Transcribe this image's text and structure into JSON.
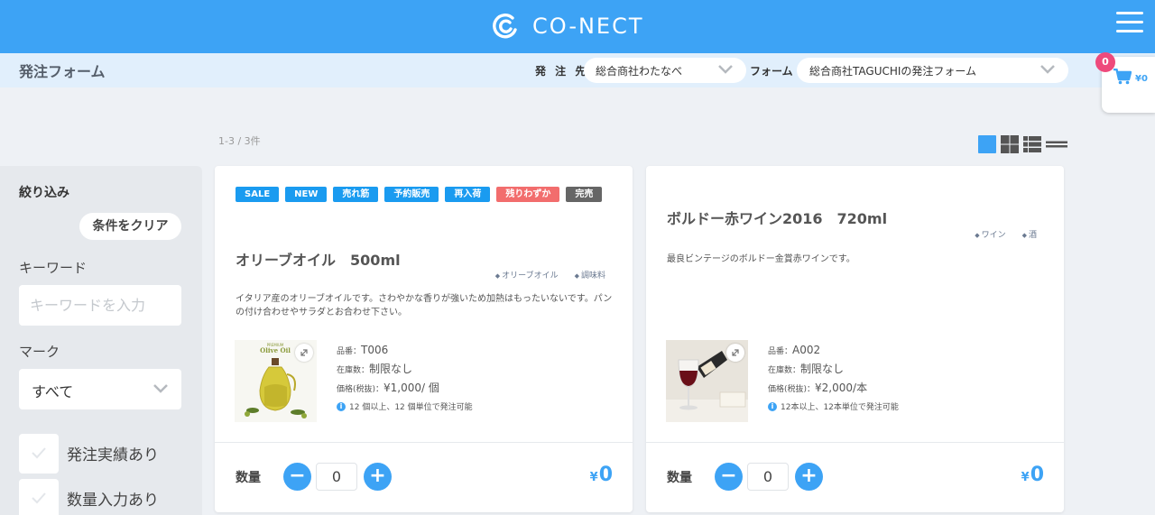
{
  "header": {
    "brand": "CO-NECT",
    "menu_icon": "hamburger-icon"
  },
  "subheader": {
    "page_title": "発注フォーム",
    "destination_label": "発 注 先",
    "destination_value": "総合商社わたなべ",
    "form_label": "フォーム",
    "form_value": "総合商社TAGUCHIの発注フォーム"
  },
  "cart": {
    "count": "0",
    "total": "¥0"
  },
  "listing": {
    "count": "1-3 / 3件"
  },
  "filters": {
    "title": "絞り込み",
    "clear_button": "条件をクリア",
    "keyword_label": "キーワード",
    "keyword_placeholder": "キーワードを入力",
    "mark_label": "マーク",
    "mark_value": "すべて",
    "checkboxes": [
      {
        "label": "発注実績あり"
      },
      {
        "label": "数量入力あり"
      }
    ]
  },
  "colors": {
    "primary": "#3da3f5",
    "tag_blue": "#1a9bf0",
    "tag_red": "#f26d6d",
    "tag_gray": "#666666"
  },
  "products": [
    {
      "tags": [
        "SALE",
        "NEW",
        "売れ筋",
        "予約販売",
        "再入荷",
        "残りわずか",
        "完売"
      ],
      "name": "オリーブオイル　500ml",
      "categories": [
        "オリーブオイル",
        "調味料"
      ],
      "description": "イタリア産のオリーブオイルです。さわやかな香りが強いため加熱はもったいないです。パンの付け合わせやサラダとお合わせ下さい。",
      "image_text": {
        "small": "PREMIUM",
        "big": "Olive Oil"
      },
      "code_label": "品番：",
      "code": "T006",
      "stock_label": "在庫数：",
      "stock": "制限なし",
      "price_label": "価格(税抜)：",
      "price": "¥1,000/ 個",
      "lot": "12 個以上、12 個単位で発注可能",
      "qty_label": "数量",
      "qty": "0",
      "subtotal": "0",
      "currency": "¥"
    },
    {
      "name": "ボルドー赤ワイン2016　720ml",
      "categories": [
        "ワイン",
        "酒"
      ],
      "description": "最良ビンテージのボルドー金賞赤ワインです。",
      "code_label": "品番：",
      "code": "A002",
      "stock_label": "在庫数：",
      "stock": "制限なし",
      "price_label": "価格(税抜)：",
      "price": "¥2,000/本",
      "lot": "12本以上、12本単位で発注可能",
      "qty_label": "数量",
      "qty": "0",
      "subtotal": "0",
      "currency": "¥"
    }
  ]
}
